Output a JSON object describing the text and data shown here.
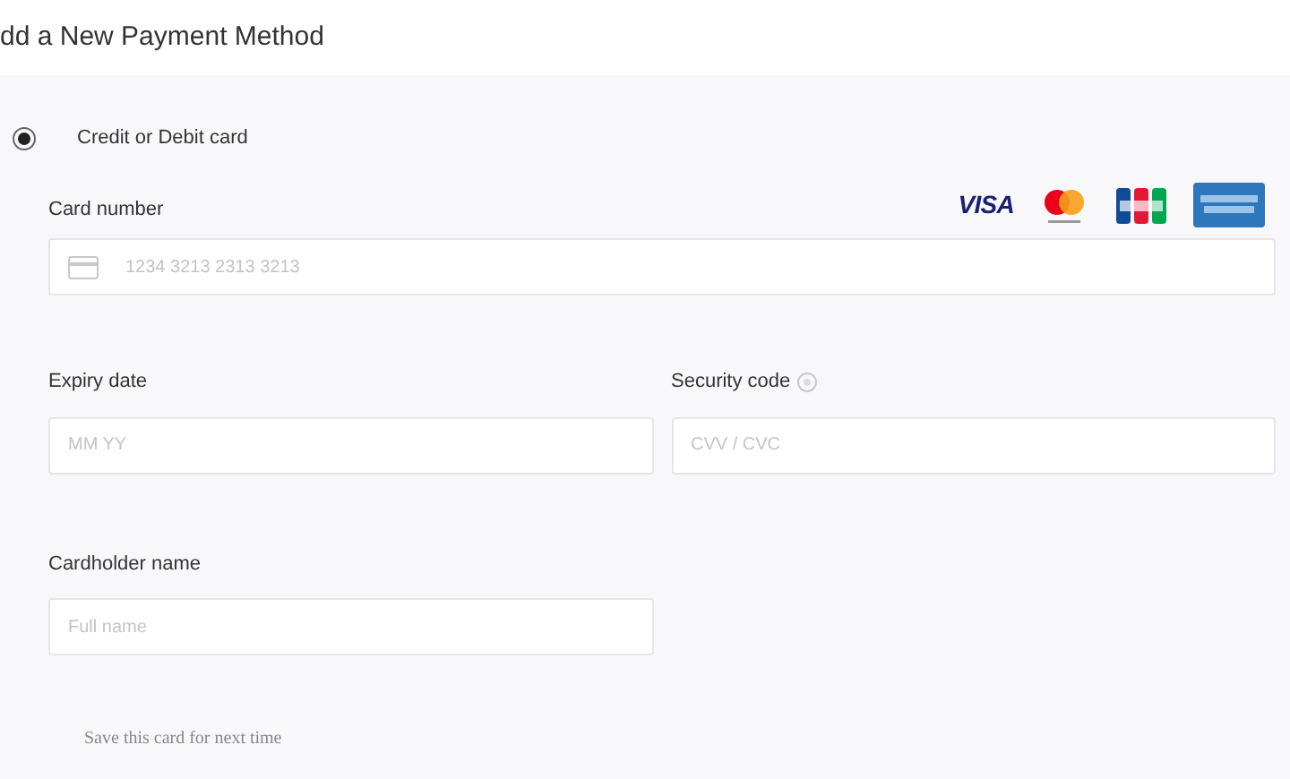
{
  "title": "dd a New Payment Method",
  "payment_option": {
    "label": "Credit or Debit card",
    "selected": true
  },
  "card_brands": [
    {
      "kind": "visa",
      "label": "VISA"
    },
    {
      "kind": "mastercard"
    },
    {
      "kind": "jcb"
    },
    {
      "kind": "amex"
    }
  ],
  "card_number": {
    "label": "Card number",
    "placeholder": "1234 3213 2313 3213"
  },
  "expiry_date": {
    "label": "Expiry date",
    "placeholder": "MM YY"
  },
  "security_code": {
    "label": "Security code",
    "placeholder": "CVV / CVC"
  },
  "cardholder_name": {
    "label": "Cardholder name",
    "placeholder": "Full name"
  },
  "save_card": {
    "label": "Save this card for next time"
  }
}
